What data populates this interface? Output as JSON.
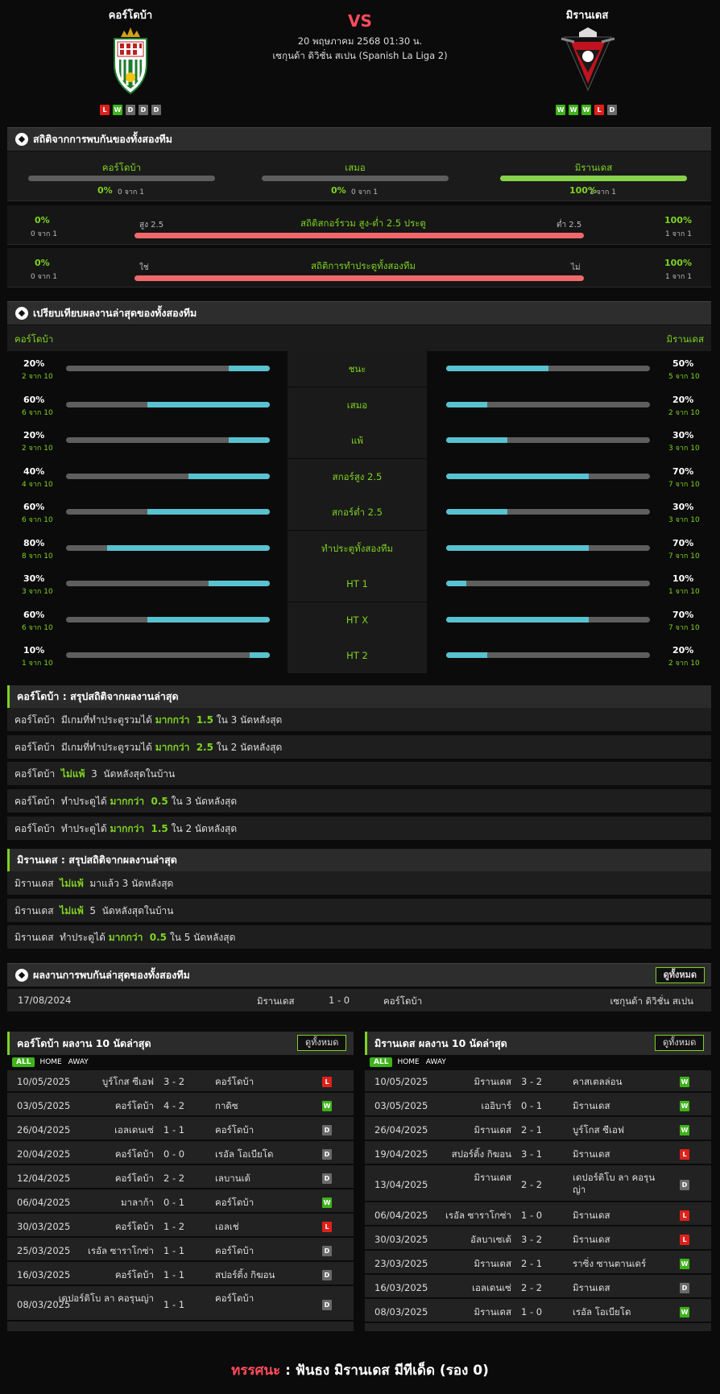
{
  "header": {
    "vs": "VS",
    "date": "20 พฤษภาคม 2568 01:30 น.",
    "league": "เซกุนด้า ดิวิชั่น สเปน (Spanish La Liga 2)",
    "home": {
      "name": "คอร์โดบ้า",
      "form": [
        "L",
        "W",
        "D",
        "D",
        "D"
      ]
    },
    "away": {
      "name": "มิรานเดส",
      "form": [
        "W",
        "W",
        "W",
        "L",
        "D"
      ]
    }
  },
  "h2h_stats": {
    "title": "สถิติจากการพบกันของทั้งสองทีม",
    "cols": [
      {
        "label": "คอร์โดบ้า",
        "pct": "0%",
        "count": "0 จาก 1",
        "fill": 0
      },
      {
        "label": "เสมอ",
        "pct": "0%",
        "count": "0 จาก 1",
        "fill": 0
      },
      {
        "label": "มิรานเดส",
        "pct": "100%",
        "count": "1 จาก 1",
        "fill": 1
      }
    ],
    "ou": {
      "title": "สถิติสกอร์รวม สูง-ต่ำ 2.5 ประตู",
      "left_label": "สูง 2.5",
      "right_label": "ต่ำ 2.5",
      "left_pct": "0%",
      "left_count": "0 จาก 1",
      "right_pct": "100%",
      "right_count": "1 จาก 1"
    },
    "btts": {
      "title": "สถิติการทำประตูทั้งสองทีม",
      "left_label": "ใช่",
      "right_label": "ไม่",
      "left_pct": "0%",
      "left_count": "0 จาก 1",
      "right_pct": "100%",
      "right_count": "1 จาก 1"
    }
  },
  "compare": {
    "title": "เปรียบเทียบผลงานล่าสุดของทั้งสองทีม",
    "home": "คอร์โดบ้า",
    "away": "มิรานเดส",
    "rows": [
      {
        "label": "ชนะ",
        "l_pct": "20%",
        "l_count": "2 จาก 10",
        "l": 0.2,
        "r_pct": "50%",
        "r_count": "5 จาก 10",
        "r": 0.5
      },
      {
        "label": "เสมอ",
        "l_pct": "60%",
        "l_count": "6 จาก 10",
        "l": 0.6,
        "r_pct": "20%",
        "r_count": "2 จาก 10",
        "r": 0.2
      },
      {
        "label": "แพ้",
        "l_pct": "20%",
        "l_count": "2 จาก 10",
        "l": 0.2,
        "r_pct": "30%",
        "r_count": "3 จาก 10",
        "r": 0.3
      },
      {
        "label": "สกอร์สูง 2.5",
        "l_pct": "40%",
        "l_count": "4 จาก 10",
        "l": 0.4,
        "r_pct": "70%",
        "r_count": "7 จาก 10",
        "r": 0.7
      },
      {
        "label": "สกอร์ต่ำ 2.5",
        "l_pct": "60%",
        "l_count": "6 จาก 10",
        "l": 0.6,
        "r_pct": "30%",
        "r_count": "3 จาก 10",
        "r": 0.3
      },
      {
        "label": "ทำประตูทั้งสองทีม",
        "l_pct": "80%",
        "l_count": "8 จาก 10",
        "l": 0.8,
        "r_pct": "70%",
        "r_count": "7 จาก 10",
        "r": 0.7
      },
      {
        "label": "HT 1",
        "l_pct": "30%",
        "l_count": "3 จาก 10",
        "l": 0.3,
        "r_pct": "10%",
        "r_count": "1 จาก 10",
        "r": 0.1
      },
      {
        "label": "HT X",
        "l_pct": "60%",
        "l_count": "6 จาก 10",
        "l": 0.6,
        "r_pct": "70%",
        "r_count": "7 จาก 10",
        "r": 0.7
      },
      {
        "label": "HT 2",
        "l_pct": "10%",
        "l_count": "1 จาก 10",
        "l": 0.1,
        "r_pct": "20%",
        "r_count": "2 จาก 10",
        "r": 0.2
      }
    ]
  },
  "home_summary": {
    "title": "คอร์โดบ้า : สรุปสถิติจากผลงานล่าสุด",
    "items": [
      {
        "a": "คอร์โดบ้า  มีเกมที่ทำประตูรวมได้ ",
        "b": "มากกว่า  1.5",
        "c": " ใน 3 นัดหลังสุด"
      },
      {
        "a": "คอร์โดบ้า  มีเกมที่ทำประตูรวมได้ ",
        "b": "มากกว่า  2.5",
        "c": " ใน 2 นัดหลังสุด"
      },
      {
        "a": "คอร์โดบ้า  ",
        "b": "ไม่แพ้",
        "c": "  3  นัดหลังสุดในบ้าน"
      },
      {
        "a": "คอร์โดบ้า  ทำประตูได้ ",
        "b": "มากกว่า  0.5",
        "c": " ใน 3 นัดหลังสุด"
      },
      {
        "a": "คอร์โดบ้า  ทำประตูได้ ",
        "b": "มากกว่า  1.5",
        "c": " ใน 2 นัดหลังสุด"
      }
    ]
  },
  "away_summary": {
    "title": "มิรานเดส : สรุปสถิติจากผลงานล่าสุด",
    "items": [
      {
        "a": "มิรานเดส  ",
        "b": "ไม่แพ้",
        "c": "  มาแล้ว 3 นัดหลังสุด"
      },
      {
        "a": "มิรานเดส  ",
        "b": "ไม่แพ้",
        "c": "  5  นัดหลังสุดในบ้าน"
      },
      {
        "a": "มิรานเดส  ทำประตูได้ ",
        "b": "มากกว่า  0.5",
        "c": " ใน 5 นัดหลังสุด"
      }
    ]
  },
  "h2h_results": {
    "title": "ผลงานการพบกันล่าสุดของทั้งสองทีม",
    "view_all": "ดูทั้งหมด",
    "row": {
      "date": "17/08/2024",
      "home": "มิรานเดส",
      "score": "1 - 0",
      "away": "คอร์โดบ้า",
      "league": "เซกุนด้า ดิวิชั่น สเปน"
    }
  },
  "home_last": {
    "title": "คอร์โดบ้า ผลงาน 10 นัดล่าสุด",
    "view_all": "ดูทั้งหมด",
    "tabs": [
      "ALL",
      "HOME",
      "AWAY"
    ],
    "rows": [
      {
        "date": "10/05/2025",
        "home": "บูร์โกส ซีเอฟ",
        "score": "3 - 2",
        "away": "คอร์โดบ้า",
        "res": "L"
      },
      {
        "date": "03/05/2025",
        "home": "คอร์โดบ้า",
        "score": "4 - 2",
        "away": "กาดิซ",
        "res": "W"
      },
      {
        "date": "26/04/2025",
        "home": "เอลเดนเซ่",
        "score": "1 - 1",
        "away": "คอร์โดบ้า",
        "res": "D"
      },
      {
        "date": "20/04/2025",
        "home": "คอร์โดบ้า",
        "score": "0 - 0",
        "away": "เรอัล โอเบียโด",
        "res": "D"
      },
      {
        "date": "12/04/2025",
        "home": "คอร์โดบ้า",
        "score": "2 - 2",
        "away": "เลบานเต้",
        "res": "D"
      },
      {
        "date": "06/04/2025",
        "home": "มาลาก้า",
        "score": "0 - 1",
        "away": "คอร์โดบ้า",
        "res": "W"
      },
      {
        "date": "30/03/2025",
        "home": "คอร์โดบ้า",
        "score": "1 - 2",
        "away": "เอลเช่",
        "res": "L"
      },
      {
        "date": "25/03/2025",
        "home": "เรอัล ซาราโกซ่า",
        "score": "1 - 1",
        "away": "คอร์โดบ้า",
        "res": "D"
      },
      {
        "date": "16/03/2025",
        "home": "คอร์โดบ้า",
        "score": "1 - 1",
        "away": "สปอร์ติ้ง กิฆอน",
        "res": "D"
      },
      {
        "date": "08/03/2025",
        "home": "เดปอร์ติโบ ลา คอรุนญ่า",
        "score": "1 - 1",
        "away": "คอร์โดบ้า",
        "res": "D"
      }
    ]
  },
  "away_last": {
    "title": "มิรานเดส ผลงาน 10 นัดล่าสุด",
    "view_all": "ดูทั้งหมด",
    "tabs": [
      "ALL",
      "HOME",
      "AWAY"
    ],
    "rows": [
      {
        "date": "10/05/2025",
        "home": "มิรานเดส",
        "score": "3 - 2",
        "away": "คาสเตลล่อน",
        "res": "W"
      },
      {
        "date": "03/05/2025",
        "home": "เออิบาร์",
        "score": "0 - 1",
        "away": "มิรานเดส",
        "res": "W"
      },
      {
        "date": "26/04/2025",
        "home": "มิรานเดส",
        "score": "2 - 1",
        "away": "บูร์โกส ซีเอฟ",
        "res": "W"
      },
      {
        "date": "19/04/2025",
        "home": "สปอร์ติ้ง กิฆอน",
        "score": "3 - 1",
        "away": "มิรานเดส",
        "res": "L"
      },
      {
        "date": "13/04/2025",
        "home": "มิรานเดส",
        "score": "2 - 2",
        "away": "เดปอร์ติโบ ลา คอรุนญ่า",
        "res": "D"
      },
      {
        "date": "06/04/2025",
        "home": "เรอัล ซาราโกซ่า",
        "score": "1 - 0",
        "away": "มิรานเดส",
        "res": "L"
      },
      {
        "date": "30/03/2025",
        "home": "อัลบาเซเต้",
        "score": "3 - 2",
        "away": "มิรานเดส",
        "res": "L"
      },
      {
        "date": "23/03/2025",
        "home": "มิรานเดส",
        "score": "2 - 1",
        "away": "ราซิ่ง ซานตานเดร์",
        "res": "W"
      },
      {
        "date": "16/03/2025",
        "home": "เอลเดนเซ่",
        "score": "2 - 2",
        "away": "มิรานเดส",
        "res": "D"
      },
      {
        "date": "08/03/2025",
        "home": "มิรานเดส",
        "score": "1 - 0",
        "away": "เรอัล โอเบียโด",
        "res": "W"
      }
    ]
  },
  "verdict": {
    "label": "ทรรศนะ",
    "sep": " :  ",
    "text": "ฟันธง มิรานเดส มีทีเด็ด (รอง 0)"
  },
  "colors": {
    "accent": "#7ed321",
    "bar_fill": "#58c2d0",
    "win": "#3eb31a",
    "loss": "#e0201a",
    "draw": "#6a6a6a"
  }
}
